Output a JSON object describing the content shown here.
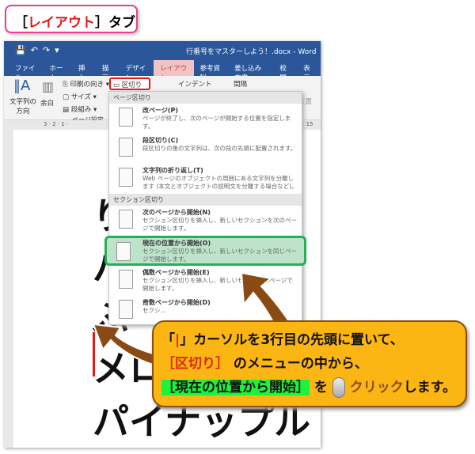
{
  "heading": {
    "prefix": "［",
    "tab": "レイアウト",
    "suffix": "］タブ"
  },
  "window": {
    "title": "行番号をマスターしよう！.docx - Word"
  },
  "tabs": [
    "ファイル",
    "ホーム",
    "挿入",
    "描画",
    "デザイン",
    "レイアウト",
    "参考資料",
    "差し込み文書",
    "校閲",
    "表示"
  ],
  "ribbon": {
    "text_direction": "文字列の方向",
    "margins": "余白",
    "orientation": "印刷の向き",
    "size": "サイズ",
    "columns": "段組み",
    "breaks": "区切り",
    "indent": "インデント",
    "spacing": "間隔",
    "position": "位置",
    "group": "ページ設定"
  },
  "ruler": {
    "left": "3 ⋅ 2 ⋅ 1 ⋅",
    "right": "14 ⋅ 15"
  },
  "doc_lines": [
    "り",
    "バ",
    "ぶ",
    "メロ",
    "パイナップル"
  ],
  "menu": {
    "section1": "ページ区切り",
    "section2": "セクション区切り",
    "items": [
      {
        "title": "改ページ(P)",
        "desc": "ページが終了し、次のページが開始する位置を指定します。"
      },
      {
        "title": "段区切り(C)",
        "desc": "段区切りの後の文字列は、次の段の先頭に配置されます。"
      },
      {
        "title": "文字列の折り返し(T)",
        "desc": "Web ページのオブジェクトの周囲にある文字列を分離します (本文とオブジェクトの説明文を分離する場合など)。"
      },
      {
        "title": "次のページから開始(N)",
        "desc": "セクション区切りを挿入し、新しいセクションを次のページで開始します。"
      },
      {
        "title": "現在の位置から開始(O)",
        "desc": "セクション区切りを挿入し、新しいセクションを同じページで開始します。"
      },
      {
        "title": "偶数ページから開始(E)",
        "desc": "セクション区切りを挿入し、新しいセ… の偶数ページで開始します。"
      },
      {
        "title": "奇数ページから開始(D)",
        "desc": "セクシ…"
      }
    ]
  },
  "callout": {
    "l1a": "「",
    "l1cursor": "|",
    "l1b": "」カーソルを3行目の先頭に置いて、",
    "l2a": "［区切り］",
    "l2b": "のメニューの中から、",
    "l3a": "［現在の位置から開始］",
    "l3b": "を",
    "l3c": "クリック",
    "l3d": "します。"
  },
  "colors": {
    "accent": "#2b579a",
    "highlight": "#25b055",
    "callout": "#fbb614",
    "red": "#e01818"
  }
}
